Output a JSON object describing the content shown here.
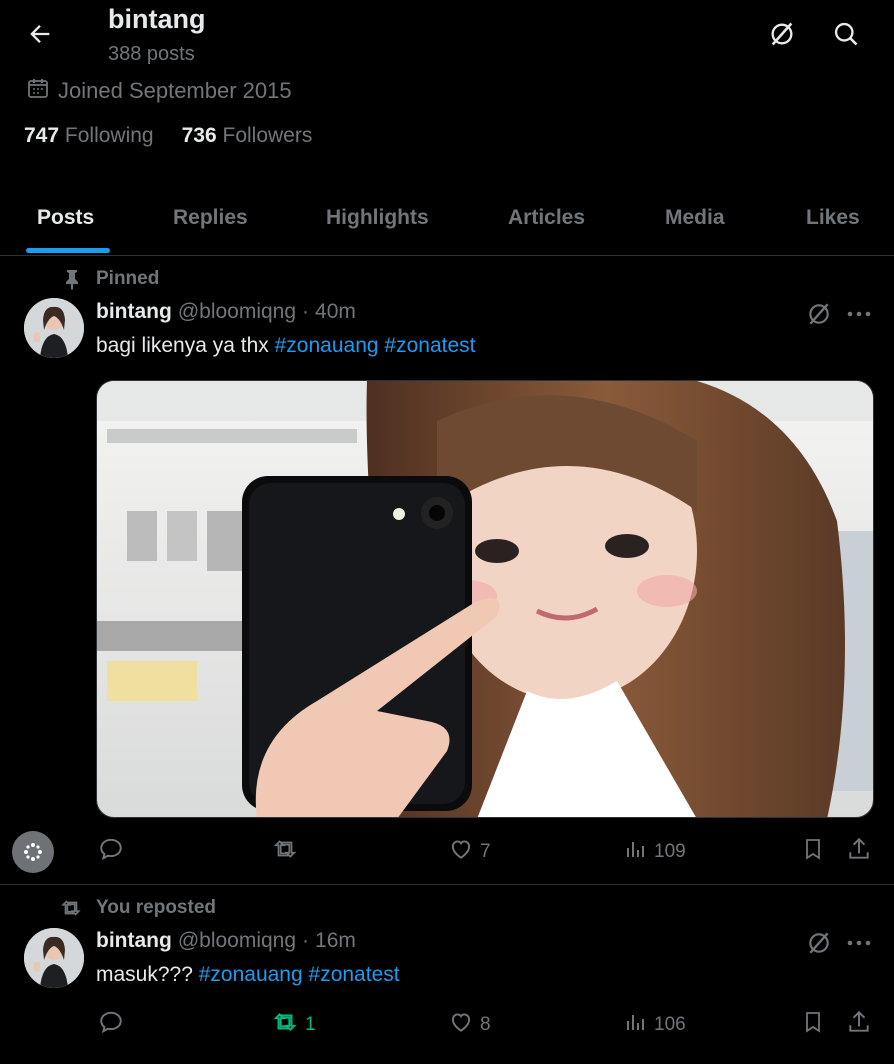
{
  "header": {
    "name": "bintang",
    "posts_count": "388 posts"
  },
  "profile": {
    "joined": "Joined September 2015",
    "following_count": "747",
    "following_label": "Following",
    "followers_count": "736",
    "followers_label": "Followers"
  },
  "tabs": [
    {
      "label": "Posts",
      "active": true
    },
    {
      "label": "Replies"
    },
    {
      "label": "Highlights"
    },
    {
      "label": "Articles"
    },
    {
      "label": "Media"
    },
    {
      "label": "Likes"
    }
  ],
  "posts": [
    {
      "context": "Pinned",
      "name": "bintang",
      "handle": "@bloomiqng",
      "sep": "·",
      "time": "40m",
      "text": "bagi likenya ya thx",
      "hashtags": [
        "#zonauang",
        "#zonatest"
      ],
      "reposts": "",
      "likes": "7",
      "views": "109"
    },
    {
      "context": "You reposted",
      "name": "bintang",
      "handle": "@bloomiqng",
      "sep": "·",
      "time": "16m",
      "text": "masuk???",
      "hashtags": [
        "#zonauang",
        "#zonatest"
      ],
      "reposts": "1",
      "likes": "8",
      "views": "106"
    }
  ],
  "colors": {
    "background": "#000000",
    "accent": "#1d9bf0",
    "muted": "#71767b",
    "repost_active": "#00ba7c"
  },
  "icons": [
    "back-arrow-icon",
    "grok-icon",
    "search-icon",
    "calendar-icon",
    "pin-icon",
    "repost-icon",
    "reply-icon",
    "like-icon",
    "views-icon",
    "bookmark-icon",
    "share-icon",
    "more-icon",
    "apps-icon"
  ]
}
